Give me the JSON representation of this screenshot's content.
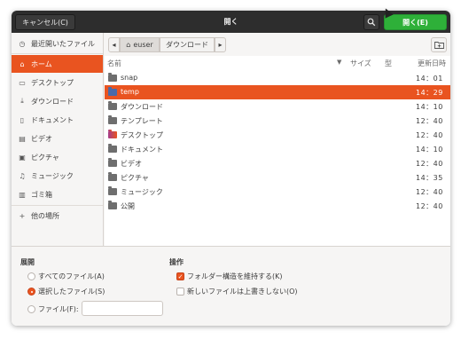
{
  "header": {
    "cancel_label": "キャンセル(C)",
    "title": "開く",
    "open_label": "開く(E)"
  },
  "sidebar": {
    "items": [
      {
        "label": "最近開いたファイル",
        "icon": "clock-icon",
        "active": false
      },
      {
        "label": "ホーム",
        "icon": "home-icon",
        "active": true
      },
      {
        "label": "デスクトップ",
        "icon": "desktop-icon",
        "active": false
      },
      {
        "label": "ダウンロード",
        "icon": "download-icon",
        "active": false
      },
      {
        "label": "ドキュメント",
        "icon": "document-icon",
        "active": false
      },
      {
        "label": "ビデオ",
        "icon": "video-icon",
        "active": false
      },
      {
        "label": "ピクチャ",
        "icon": "picture-icon",
        "active": false
      },
      {
        "label": "ミュージック",
        "icon": "music-icon",
        "active": false
      },
      {
        "label": "ゴミ箱",
        "icon": "trash-icon",
        "active": false
      }
    ],
    "other_locations": "他の場所"
  },
  "pathbar": {
    "home_label": "euser",
    "next_label": "ダウンロード"
  },
  "columns": {
    "name": "名前",
    "size": "サイズ",
    "type": "型",
    "modified": "更新日時"
  },
  "files": [
    {
      "name": "snap",
      "time": "14：01",
      "selected": false
    },
    {
      "name": "temp",
      "time": "14：29",
      "selected": true
    },
    {
      "name": "ダウンロード",
      "time": "14：10",
      "selected": false
    },
    {
      "name": "テンプレート",
      "time": "12：40",
      "selected": false
    },
    {
      "name": "デスクトップ",
      "time": "12：40",
      "selected": false
    },
    {
      "name": "ドキュメント",
      "time": "14：10",
      "selected": false
    },
    {
      "name": "ビデオ",
      "time": "12：40",
      "selected": false
    },
    {
      "name": "ピクチャ",
      "time": "14：35",
      "selected": false
    },
    {
      "name": "ミュージック",
      "time": "12：40",
      "selected": false
    },
    {
      "name": "公開",
      "time": "12：40",
      "selected": false
    }
  ],
  "options": {
    "open_group_label": "展開",
    "all_files": "すべてのファイル(A)",
    "selected_files": "選択したファイル(S)",
    "files_field": "ファイル(F):",
    "files_field_value": "",
    "operation_group_label": "操作",
    "keep_structure": "フォルダー構造を維持する(K)",
    "keep_structure_checked": true,
    "no_overwrite": "新しいファイルは上書きしない(O)",
    "no_overwrite_checked": false,
    "selected_radio": "selected_files"
  },
  "colors": {
    "accent": "#e95420",
    "open_button": "#2eb039",
    "header_bg": "#2d2d2d"
  }
}
